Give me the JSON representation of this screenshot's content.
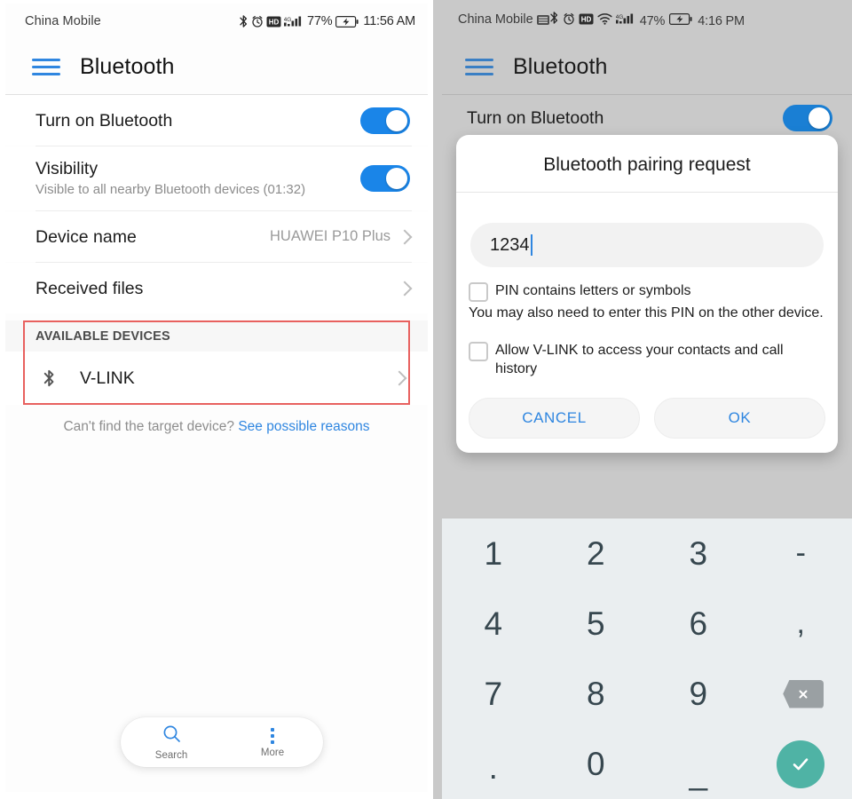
{
  "left": {
    "statusbar": {
      "carrier": "China Mobile",
      "battery_pct": "77%",
      "clock": "11:56 AM",
      "icons": [
        "bluetooth-icon",
        "alarm-icon",
        "hd-icon",
        "signal-4g-icon",
        "battery-icon"
      ]
    },
    "appbar": {
      "title": "Bluetooth",
      "menu_icon": "hamburger-icon"
    },
    "rows": [
      {
        "title": "Turn on Bluetooth",
        "control": "toggle",
        "state": "on"
      },
      {
        "title": "Visibility",
        "subtitle": "Visible to all nearby Bluetooth devices (01:32)",
        "control": "toggle",
        "state": "on"
      },
      {
        "title": "Device name",
        "value": "HUAWEI P10 Plus",
        "control": "chevron"
      },
      {
        "title": "Received files",
        "value": "",
        "control": "chevron"
      }
    ],
    "available_section": {
      "header": "AVAILABLE DEVICES",
      "device": {
        "name": "V-LINK",
        "icon": "bluetooth-icon"
      }
    },
    "hint": {
      "text": "Can't find the target device?",
      "link": "See possible reasons"
    },
    "navbar": [
      {
        "label": "Search",
        "icon": "search-icon"
      },
      {
        "label": "More",
        "icon": "overflow-dots-icon"
      }
    ]
  },
  "right": {
    "statusbar": {
      "carrier": "China Mobile",
      "battery_pct": "47%",
      "clock": "4:16 PM",
      "icons": [
        "sim-card-icon",
        "bluetooth-icon",
        "alarm-icon",
        "hd-icon",
        "wifi-icon",
        "signal-4g-icon",
        "battery-icon"
      ]
    },
    "appbar": {
      "title": "Bluetooth",
      "menu_icon": "hamburger-icon"
    },
    "bg_row": {
      "title": "Turn on Bluetooth",
      "control": "toggle",
      "state": "on"
    },
    "dialog": {
      "title": "Bluetooth pairing request",
      "pin_value": "1234",
      "pin_placeholder": "",
      "checkbox_pin": {
        "label": "PIN contains letters or symbols",
        "checked": false
      },
      "note": "You may also need to enter this PIN on the other device.",
      "checkbox_contacts": {
        "label": "Allow V-LINK to access your contacts and call history",
        "checked": false
      },
      "cancel_label": "CANCEL",
      "ok_label": "OK"
    },
    "keypad": {
      "keys": [
        {
          "label": "1",
          "type": "digit"
        },
        {
          "label": "2",
          "type": "digit"
        },
        {
          "label": "3",
          "type": "digit"
        },
        {
          "label": "-",
          "type": "symbol"
        },
        {
          "label": "4",
          "type": "digit"
        },
        {
          "label": "5",
          "type": "digit"
        },
        {
          "label": "6",
          "type": "digit"
        },
        {
          "label": ",",
          "type": "symbol"
        },
        {
          "label": "7",
          "type": "digit"
        },
        {
          "label": "8",
          "type": "digit"
        },
        {
          "label": "9",
          "type": "digit"
        },
        {
          "label": "",
          "type": "backspace-icon"
        },
        {
          "label": ".",
          "type": "symbol"
        },
        {
          "label": "0",
          "type": "digit"
        },
        {
          "label": "_",
          "type": "symbol"
        },
        {
          "label": "",
          "type": "confirm-check-icon"
        }
      ]
    }
  },
  "colors": {
    "accent_blue": "#1a85e8",
    "link_blue": "#2f86e0",
    "highlight_red": "#e8615f",
    "confirm_teal": "#4fb3a5",
    "keypad_bg": "#eaeef0",
    "phone_bg_gray": "#c9c9c9"
  }
}
